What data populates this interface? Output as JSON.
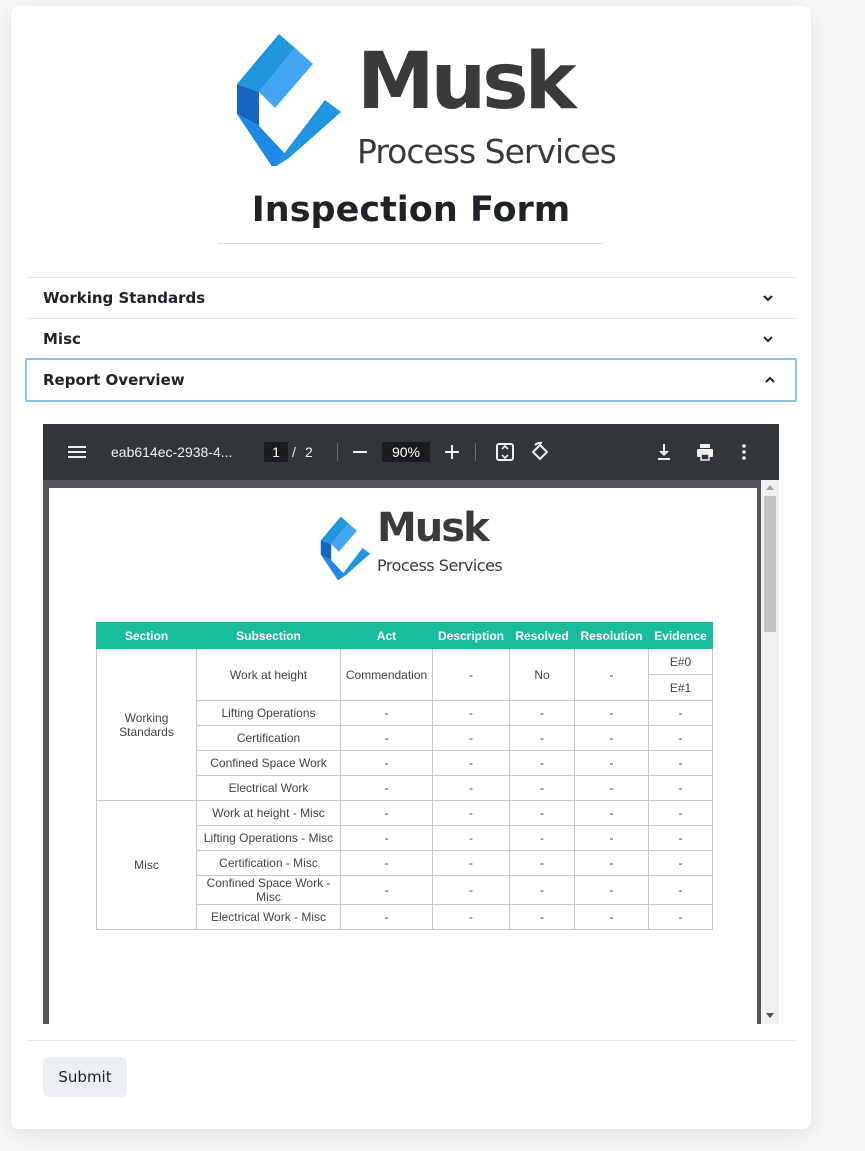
{
  "brand": {
    "name": "Musk",
    "subtitle": "Process Services",
    "colors": {
      "blue": "#2196e0",
      "text": "#3a3a3a"
    }
  },
  "page_title": "Inspection Form",
  "accordion": [
    {
      "label": "Working Standards",
      "state": "collapsed",
      "icon": "chevron-down-icon"
    },
    {
      "label": "Misc",
      "state": "collapsed",
      "icon": "chevron-down-icon"
    },
    {
      "label": "Report Overview",
      "state": "expanded",
      "icon": "chevron-up-icon"
    }
  ],
  "pdf_viewer": {
    "filename": "eab614ec-2938-4...",
    "current_page": "1",
    "page_separator": "/",
    "total_pages": "2",
    "zoom": "90%",
    "icons": [
      "menu-icon",
      "zoom-out-icon",
      "zoom-in-icon",
      "fit-page-icon",
      "rotate-icon",
      "download-icon",
      "print-icon",
      "more-icon"
    ]
  },
  "report": {
    "brand_name": "Musk",
    "brand_subtitle": "Process Services",
    "header_color": "#1abc9c",
    "columns": [
      "Section",
      "Subsection",
      "Act",
      "Description",
      "Resolved",
      "Resolution",
      "Evidence"
    ],
    "sections": [
      {
        "name": "Working Standards",
        "rows": [
          {
            "subsection": "Work at height",
            "act": "Commendation",
            "description": "-",
            "resolved": "No",
            "resolution": "-",
            "evidence": [
              "E#0",
              "E#1"
            ]
          },
          {
            "subsection": "Lifting Operations",
            "act": "-",
            "description": "-",
            "resolved": "-",
            "resolution": "-",
            "evidence": [
              "-"
            ]
          },
          {
            "subsection": "Certification",
            "act": "-",
            "description": "-",
            "resolved": "-",
            "resolution": "-",
            "evidence": [
              "-"
            ]
          },
          {
            "subsection": "Confined Space Work",
            "act": "-",
            "description": "-",
            "resolved": "-",
            "resolution": "-",
            "evidence": [
              "-"
            ]
          },
          {
            "subsection": "Electrical Work",
            "act": "-",
            "description": "-",
            "resolved": "-",
            "resolution": "-",
            "evidence": [
              "-"
            ]
          }
        ]
      },
      {
        "name": "Misc",
        "rows": [
          {
            "subsection": "Work at height - Misc",
            "act": "-",
            "description": "-",
            "resolved": "-",
            "resolution": "-",
            "evidence": [
              "-"
            ]
          },
          {
            "subsection": "Lifting Operations - Misc",
            "act": "-",
            "description": "-",
            "resolved": "-",
            "resolution": "-",
            "evidence": [
              "-"
            ]
          },
          {
            "subsection": "Certification - Misc",
            "act": "-",
            "description": "-",
            "resolved": "-",
            "resolution": "-",
            "evidence": [
              "-"
            ]
          },
          {
            "subsection": "Confined Space Work - Misc",
            "act": "-",
            "description": "-",
            "resolved": "-",
            "resolution": "-",
            "evidence": [
              "-"
            ]
          },
          {
            "subsection": "Electrical Work - Misc",
            "act": "-",
            "description": "-",
            "resolved": "-",
            "resolution": "-",
            "evidence": [
              "-"
            ]
          }
        ]
      }
    ]
  },
  "submit_label": "Submit"
}
